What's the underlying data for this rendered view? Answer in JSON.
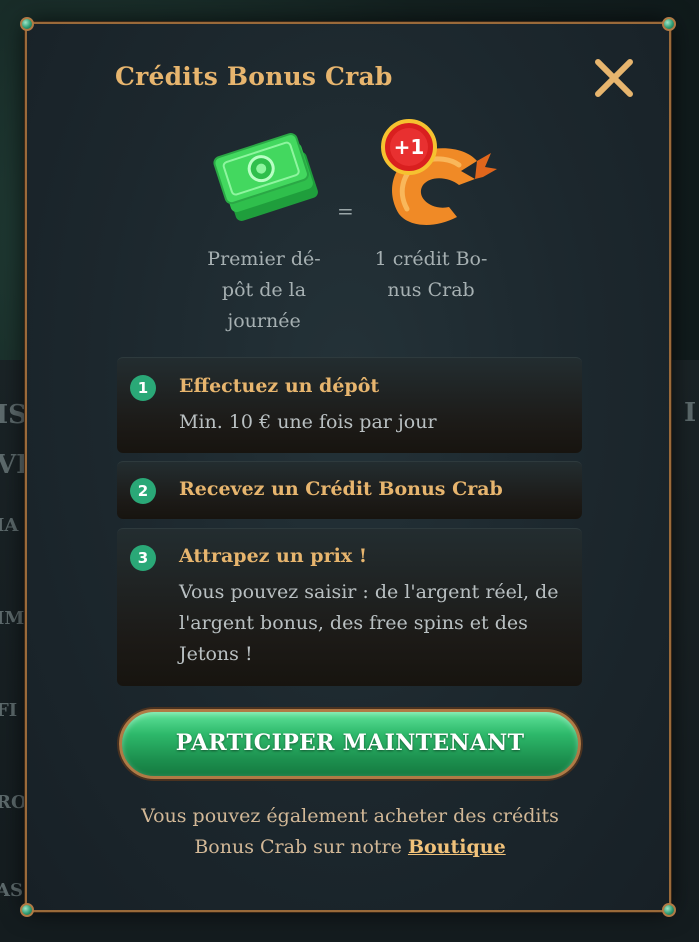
{
  "background": {
    "letters": [
      "IS",
      "VI",
      "IA",
      "IM",
      "FI",
      "RO",
      "AS",
      "I"
    ]
  },
  "modal": {
    "title": "Crédits Bonus Crab",
    "close_icon": "close-icon",
    "equation": {
      "left_icon": "money-stack-icon",
      "left_caption_lines": [
        "Premier dé-",
        "pôt de la",
        "journée"
      ],
      "equals": "=",
      "right_icon": "crab-claw-icon",
      "right_badge": "+1",
      "right_caption_lines": [
        "1 crédit Bo-",
        "nus Crab"
      ]
    },
    "steps": [
      {
        "number": "1",
        "title": "Effectuez un dépôt",
        "description": "Min. 10 € une fois par jour"
      },
      {
        "number": "2",
        "title": "Recevez un Crédit Bonus Crab",
        "description": ""
      },
      {
        "number": "3",
        "title": "Attrapez un prix !",
        "description_lines": [
          "Vous pouvez saisir : de l'argent réel, de",
          "l'argent bonus, des free spins et des",
          "Jetons !"
        ]
      }
    ],
    "cta_label": "PARTICIPER MAINTENANT",
    "footer": {
      "line1": "Vous pouvez également acheter des crédits",
      "line2_prefix": "Bonus Crab sur notre ",
      "shop_link": "Boutique"
    },
    "colors": {
      "title": "#e7b56e",
      "accent_green": "#2aa877",
      "border_bronze": "#9a6a3a"
    }
  }
}
